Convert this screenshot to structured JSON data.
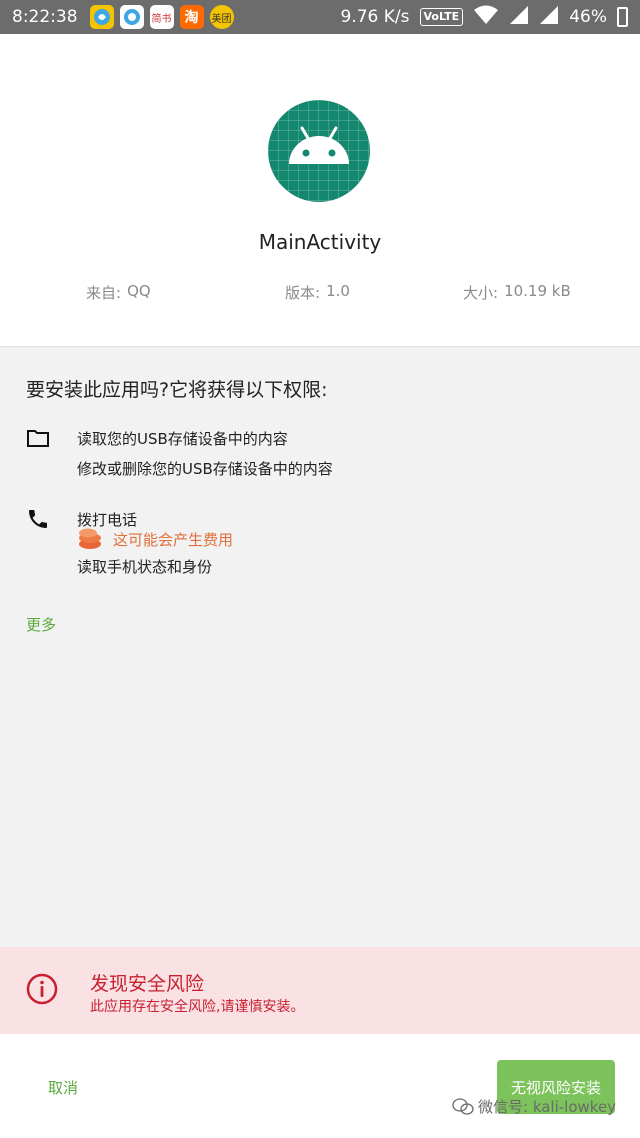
{
  "status_bar": {
    "time": "8:22:38",
    "apps": [
      {
        "name": "app-1",
        "label": "",
        "color": "#f5c400"
      },
      {
        "name": "app-2",
        "label": "",
        "color": "#3da7e6"
      },
      {
        "name": "app-3",
        "label": "简书",
        "color": "#ffffff"
      },
      {
        "name": "app-4",
        "label": "淘",
        "color": "#ff6a00"
      },
      {
        "name": "app-5",
        "label": "美团",
        "color": "#f5c400"
      }
    ],
    "network_speed": "9.76 K/s",
    "volte": "VoLTE",
    "battery": "46%"
  },
  "app_info": {
    "name": "MainActivity",
    "source_label": "来自:",
    "source_value": "QQ",
    "version_label": "版本:",
    "version_value": "1.0",
    "size_label": "大小:",
    "size_value": "10.19 kB",
    "icon_color": "#14876f"
  },
  "permissions": {
    "title": "要安装此应用吗?它将获得以下权限:",
    "groups": [
      {
        "icon": "folder-icon",
        "items": [
          "读取您的USB存储设备中的内容",
          "修改或删除您的USB存储设备中的内容"
        ]
      },
      {
        "icon": "phone-icon",
        "items": [
          "拨打电话",
          "读取手机状态和身份"
        ],
        "warning": "这可能会产生费用"
      }
    ],
    "more": "更多"
  },
  "risk": {
    "title": "发现安全风险",
    "description": "此应用存在安全风险,请谨慎安装。",
    "color": "#c8202f"
  },
  "actions": {
    "cancel": "取消",
    "install": "无视风险安装",
    "accent": "#7cc35c"
  },
  "watermark": "微信号: kali-lowkey"
}
